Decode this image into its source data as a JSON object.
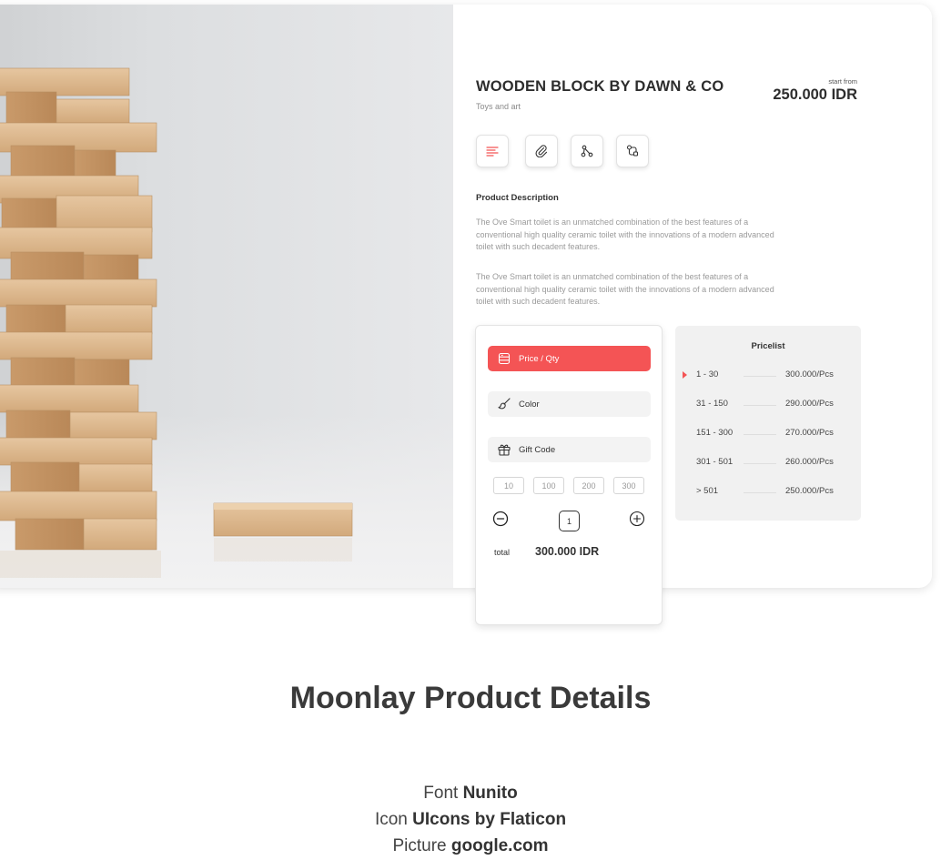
{
  "product": {
    "title": "WOODEN BLOCK BY DAWN & CO",
    "category": "Toys and art",
    "start_from_label": "start from",
    "start_price": "250.000 IDR"
  },
  "toolbar": {
    "icons": [
      "description-icon",
      "paperclip-icon",
      "share-icon",
      "compare-icon"
    ]
  },
  "description": {
    "title": "Product Description",
    "paragraphs": [
      "The Ove Smart toilet is an unmatched combination of the best features of a conventional high quality ceramic toilet with the innovations of a modern advanced toilet with such decadent features.",
      "The Ove Smart toilet is an unmatched combination of the best features of a conventional high quality ceramic toilet with the innovations of a modern advanced toilet with such decadent features."
    ]
  },
  "order": {
    "options": [
      {
        "label": "Price / Qty",
        "icon": "pricelist-icon",
        "active": true
      },
      {
        "label": "Color",
        "icon": "paint-brush-icon",
        "active": false
      },
      {
        "label": "Gift Code",
        "icon": "gift-icon",
        "active": false
      }
    ],
    "quick_qty": [
      "10",
      "100",
      "200",
      "300"
    ],
    "quantity": "1",
    "total_label": "total",
    "total_value": "300.000 IDR"
  },
  "pricelist": {
    "title": "Pricelist",
    "rows": [
      {
        "range": "1 - 30",
        "price": "300.000/Pcs",
        "selected": true
      },
      {
        "range": "31 - 150",
        "price": "290.000/Pcs",
        "selected": false
      },
      {
        "range": "151 - 300",
        "price": "270.000/Pcs",
        "selected": false
      },
      {
        "range": "301 - 501",
        "price": "260.000/Pcs",
        "selected": false
      },
      {
        "range": "> 501",
        "price": "250.000/Pcs",
        "selected": false
      }
    ]
  },
  "caption": {
    "heading": "Moonlay Product Details",
    "credits": [
      {
        "label": "Font",
        "value": "Nunito"
      },
      {
        "label": "Icon",
        "value": "UIcons by Flaticon"
      },
      {
        "label": "Picture",
        "value": "google.com"
      }
    ]
  },
  "colors": {
    "accent": "#f45455",
    "text_dark": "#2d2d2d",
    "muted": "#9a9a9a",
    "panel_bg": "#f1f1f1"
  }
}
